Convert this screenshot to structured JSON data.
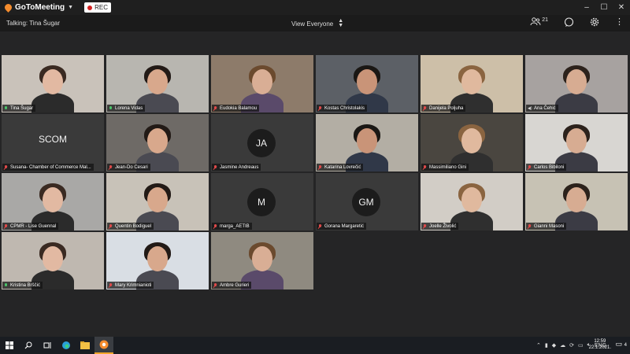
{
  "app": {
    "name": "GoToMeeting",
    "rec_label": "REC"
  },
  "window_controls": [
    "–",
    "☐",
    "✕"
  ],
  "toolbar": {
    "talking": "Talking: Tina Šugar",
    "view": "View Everyone",
    "attendee_count": "21"
  },
  "participants": [
    {
      "name": "Tina Šugar",
      "mic": "on",
      "video": true
    },
    {
      "name": "Lorena Vidas",
      "mic": "on",
      "video": true
    },
    {
      "name": "Eudokia Balamou",
      "mic": "muted",
      "video": true
    },
    {
      "name": "Kostas Christolakis",
      "mic": "muted",
      "video": true
    },
    {
      "name": "Danijela Poljuha",
      "mic": "muted",
      "video": true
    },
    {
      "name": "Ana Čehić",
      "mic": "speaker",
      "video": true
    },
    {
      "name": "Susana- Chamber of Commerce Mal...",
      "mic": "muted",
      "video": false,
      "initials": "SCOM"
    },
    {
      "name": "Jean-Do Cesari",
      "mic": "muted",
      "video": true
    },
    {
      "name": "Jasmine Andreaus",
      "mic": "muted",
      "video": false,
      "initials": "JA"
    },
    {
      "name": "Katarina Lovrečić",
      "mic": "muted",
      "video": true
    },
    {
      "name": "Massimiliano Gini",
      "mic": "muted",
      "video": true
    },
    {
      "name": "Carlos Bibiloni",
      "mic": "muted",
      "video": true
    },
    {
      "name": "CPMR - Lise Guennal",
      "mic": "muted",
      "video": true
    },
    {
      "name": "Quentin Bodiguel",
      "mic": "muted",
      "video": true
    },
    {
      "name": "marga_AETIB",
      "mic": "muted",
      "video": false,
      "initials": "M"
    },
    {
      "name": "Gorana Margaretić",
      "mic": "muted",
      "video": false,
      "initials": "GM"
    },
    {
      "name": "Joelle Živolić",
      "mic": "muted",
      "video": true
    },
    {
      "name": "Gianni Masoni",
      "mic": "muted",
      "video": true
    },
    {
      "name": "Kristina Brščić",
      "mic": "on",
      "video": true
    },
    {
      "name": "Mary Krimnianioti",
      "mic": "muted",
      "video": true
    },
    {
      "name": "Ambre Gurieri",
      "mic": "muted",
      "video": true
    }
  ],
  "taskbar": {
    "start_icon": "windows-start-icon",
    "search_icon": "search-icon",
    "taskview_icon": "task-view-icon",
    "apps": [
      "edge-icon",
      "file-explorer-icon",
      "gotomeeting-icon"
    ],
    "time": "12:59",
    "date": "22.1.2021.",
    "notifications": "4"
  },
  "colors": {
    "accent": "#f68d2e",
    "muted": "#e04a4a",
    "active_mic": "#4bc46a"
  }
}
